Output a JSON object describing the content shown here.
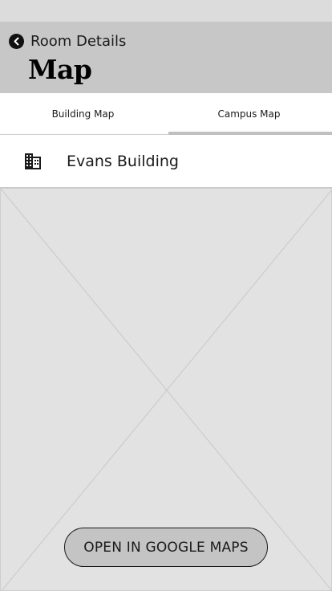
{
  "header": {
    "back_label": "Room Details",
    "title": "Map"
  },
  "tabs": [
    {
      "label": "Building Map",
      "active": false
    },
    {
      "label": "Campus Map",
      "active": true
    }
  ],
  "location": {
    "icon": "building-icon",
    "name": "Evans Building"
  },
  "map": {
    "placeholder": "image-placeholder"
  },
  "actions": {
    "open_maps_label": "OPEN IN GOOGLE MAPS"
  },
  "colors": {
    "header_bg": "#c7c7c7",
    "status_bar": "#dcdcdc",
    "map_bg": "#e2e2e2",
    "tab_indicator": "#c0c0c0",
    "button_bg": "#c4c4c4"
  }
}
